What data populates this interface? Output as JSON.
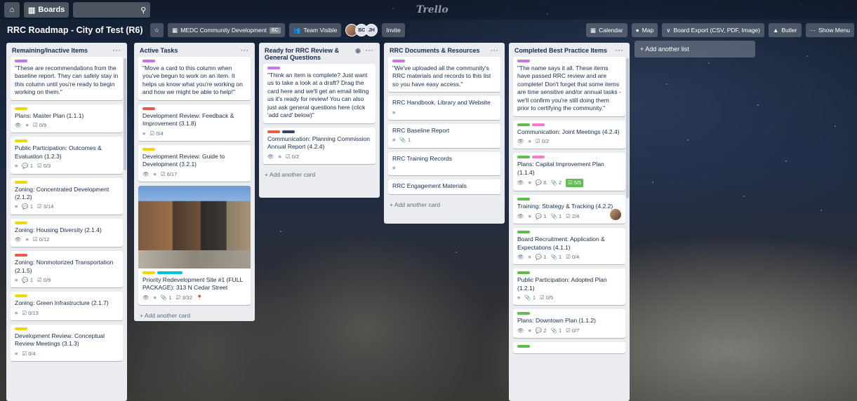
{
  "appbar": {
    "home_icon": "home-icon",
    "boards_label": "Boards",
    "search_icon": "search-icon",
    "logo": "Trello",
    "right_icons": [
      "plus-icon",
      "info-icon",
      "bell-icon"
    ]
  },
  "board": {
    "title": "RRC Roadmap - City of Test (R6)",
    "team_label": "MEDC Community Development",
    "team_badge": "BC",
    "visibility_label": "Team Visible",
    "members": [
      "BC",
      "JH"
    ],
    "invite_label": "Invite",
    "calendar_label": "Calendar",
    "map_label": "Map",
    "export_label": "Board Export (CSV, PDF, Image)",
    "butler_label": "Butler",
    "show_menu_label": "Show Menu"
  },
  "lists": [
    {
      "title": "Remaining/Inactive Items",
      "cards": [
        {
          "labels": [
            "purple"
          ],
          "text": "\"These are recommendations from the baseline report. They can safely stay in this column until you're ready to begin working on them.\"",
          "badges": []
        },
        {
          "labels": [
            "yellow"
          ],
          "text": "Plans: Master Plan (1.1.1)",
          "badges": [
            "👁",
            "≡",
            "☑ 0/9"
          ]
        },
        {
          "labels": [
            "yellow"
          ],
          "text": "Public Participation: Outcomes & Evaluation (1.2.3)",
          "badges": [
            "≡",
            "💬 1",
            "☑ 0/3"
          ]
        },
        {
          "labels": [
            "yellow"
          ],
          "text": "Zoning: Concentrated Development (2.1.2)",
          "badges": [
            "≡",
            "💬 1",
            "☑ 3/14"
          ]
        },
        {
          "labels": [
            "yellow"
          ],
          "text": "Zoning: Housing Diversity (2.1.4)",
          "badges": [
            "👁",
            "≡",
            "☑ 0/12"
          ]
        },
        {
          "labels": [
            "red"
          ],
          "text": "Zoning: Nonmotorized Transportation (2.1.5)",
          "badges": [
            "≡",
            "💬 1",
            "☑ 0/9"
          ]
        },
        {
          "labels": [
            "yellow"
          ],
          "text": "Zoning: Green Infrastructure (2.1.7)",
          "badges": [
            "≡",
            "☑ 0/13"
          ]
        },
        {
          "labels": [
            "yellow"
          ],
          "text": "Development Review: Conceptual Review Meetings (3.1.3)",
          "badges": [
            "≡",
            "☑ 0/4"
          ]
        }
      ]
    },
    {
      "title": "Active Tasks",
      "cards": [
        {
          "labels": [
            "purple"
          ],
          "text": "\"Move a card to this column when you've begun to work on an item. It helps us know what you're working on and how we might be able to help!\"",
          "badges": []
        },
        {
          "labels": [
            "red"
          ],
          "text": "Development Review: Feedback & Improvement (3.1.8)",
          "badges": [
            "≡",
            "☑ 0/4"
          ]
        },
        {
          "labels": [
            "yellow"
          ],
          "text": "Development Review: Guide to Development (3.2.1)",
          "badges": [
            "👁",
            "≡",
            "☑ 6/17"
          ]
        },
        {
          "labels": [
            "yellow",
            "sky"
          ],
          "text": "Priority Redevelopment Site #1 (FULL PACKAGE): 313 N Cedar Street",
          "badges": [
            "👁",
            "≡",
            "📎 1",
            "☑ 3/32",
            "📍"
          ],
          "cover": true
        }
      ],
      "add_label": "+ Add another card"
    },
    {
      "title": "Ready for RRC Review & General Questions",
      "cards": [
        {
          "labels": [
            "purple"
          ],
          "text": "\"Think an item is complete? Just want us to take a look at a draft? Drag the card here and we'll get an email telling us it's ready for review! You can also just ask general questions here (click 'add card' below)\"",
          "badges": []
        },
        {
          "labels": [
            "red",
            "black"
          ],
          "text": "Communication: Planning Commission Annual Report (4.2.4)",
          "badges": [
            "👁",
            "≡",
            "☑ 0/2"
          ]
        }
      ],
      "add_label": "+ Add another card"
    },
    {
      "title": "RRC Documents & Resources",
      "cards": [
        {
          "labels": [
            "purple"
          ],
          "text": "\"We've uploaded all the community's RRC materials and records to this list so you have easy access.\"",
          "badges": []
        },
        {
          "labels": [],
          "text": "RRC Handbook, Library and Website",
          "badges": [
            "≡"
          ]
        },
        {
          "labels": [],
          "text": "RRC Baseline Report",
          "badges": [
            "≡",
            "📎 1"
          ]
        },
        {
          "labels": [],
          "text": "RRC Training Records",
          "badges": [
            "≡"
          ]
        },
        {
          "labels": [],
          "text": "RRC Engagement Materials",
          "badges": []
        }
      ],
      "add_label": "+ Add another card"
    },
    {
      "title": "Completed Best Practice Items",
      "cards": [
        {
          "labels": [
            "purple"
          ],
          "text": "\"The name says it all. These items have passed RRC review and are complete! Don't forget that some items are time sensitive and/or annual tasks - we'll confirm you're still doing them prior to certifying the community.\"",
          "badges": []
        },
        {
          "labels": [
            "green",
            "pink"
          ],
          "text": "Communication: Joint Meetings (4.2.4)",
          "badges": [
            "👁",
            "≡",
            "☑ 0/2"
          ]
        },
        {
          "labels": [
            "green",
            "pink"
          ],
          "text": "Plans: Capital Improvement Plan (1.1.4)",
          "badges": [
            "👁",
            "≡",
            "💬 6",
            "📎 2"
          ],
          "done": "☑ 5/5"
        },
        {
          "labels": [
            "green"
          ],
          "text": "Training: Strategy & Tracking (4.2.2)",
          "badges": [
            "👁",
            "≡",
            "💬 1",
            "📎 1",
            "☑ 2/4"
          ],
          "member": true
        },
        {
          "labels": [
            "green"
          ],
          "text": "Board Recruitment: Application & Expectations (4.1.1)",
          "badges": [
            "👁",
            "≡",
            "💬 1",
            "📎 1",
            "☑ 0/4"
          ]
        },
        {
          "labels": [
            "green"
          ],
          "text": "Public Participation: Adopted Plan (1.2.1)",
          "badges": [
            "≡",
            "📎 1",
            "☑ 0/5"
          ]
        },
        {
          "labels": [
            "green"
          ],
          "text": "Plans: Downtown Plan (1.1.2)",
          "badges": [
            "👁",
            "≡",
            "💬 2",
            "📎 1",
            "☑ 0/7"
          ]
        },
        {
          "labels": [
            "green"
          ],
          "text": "",
          "badges": []
        }
      ]
    }
  ],
  "add_list_label": "+ Add another list"
}
